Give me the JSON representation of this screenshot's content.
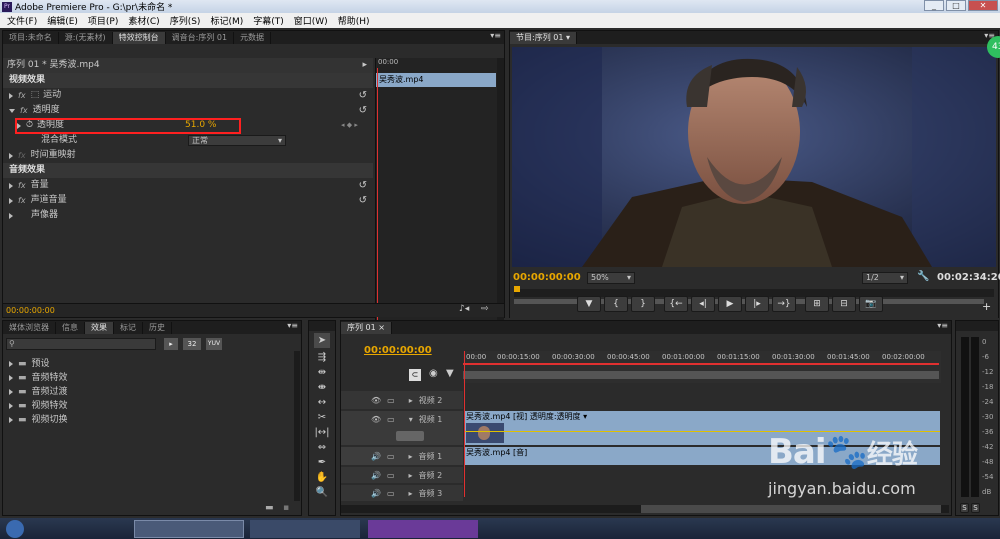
{
  "window": {
    "title": "Adobe Premiere Pro - G:\\pr\\未命名 *",
    "logo": "Pr"
  },
  "menu": [
    "文件(F)",
    "编辑(E)",
    "项目(P)",
    "素材(C)",
    "序列(S)",
    "标记(M)",
    "字幕(T)",
    "窗口(W)",
    "帮助(H)"
  ],
  "top_left_tabs": [
    "项目:未命名",
    "源:(无素材)",
    "特效控制台",
    "调音台:序列 01",
    "元数据"
  ],
  "effect_controls": {
    "clip_header": "序列 01 * 吴秀波.mp4",
    "clip_bar_label": "吴秀波.mp4",
    "mini_timecode": "00:00",
    "video_section": "视频效果",
    "rows": {
      "motion": "运动",
      "opacity": "透明度",
      "opacity_param": "透明度",
      "opacity_value": "51.0 %",
      "blend_mode": "混合模式",
      "blend_value": "正常",
      "time_remap": "时间重映射"
    },
    "audio_section": "音频效果",
    "audio_rows": [
      "音量",
      "声道音量",
      "声像器"
    ],
    "footer_timecode": "00:00:00:00",
    "fx_label": "fx"
  },
  "program": {
    "tab": "节目:序列 01",
    "timecode_current": "00:00:00:00",
    "zoom": "50%",
    "resolution": "1/2",
    "timecode_duration": "00:02:34:20"
  },
  "bottom_left_tabs": [
    "媒体浏览器",
    "信息",
    "效果",
    "标记",
    "历史"
  ],
  "effects_search_placeholder": "",
  "effects_badges": [
    "32",
    "YUV"
  ],
  "effects_folders": [
    "预设",
    "音频特效",
    "音频过渡",
    "视频特效",
    "视频切换"
  ],
  "timeline": {
    "tab": "序列 01",
    "timecode": "00:00:00:00",
    "ruler": [
      "00:00",
      "00:00:15:00",
      "00:00:30:00",
      "00:00:45:00",
      "00:01:00:00",
      "00:01:15:00",
      "00:01:30:00",
      "00:01:45:00",
      "00:02:00:00"
    ],
    "tracks": {
      "v2": "视频 2",
      "v1": "视频 1",
      "a1": "音频 1",
      "a2": "音频 2",
      "a3": "音频 3"
    },
    "video_clip": "吴秀波.mp4 [视] 透明度:透明度 ▾",
    "audio_clip": "吴秀波.mp4 [音]"
  },
  "meter_labels": [
    "0",
    "-6",
    "-12",
    "-18",
    "-24",
    "-30",
    "-36",
    "-42",
    "-48",
    "-54",
    "dB"
  ],
  "meter_buttons": [
    "S",
    "S"
  ],
  "watermark": {
    "brand": "Bai",
    "brand_suffix": "经验",
    "url": "jingyan.baidu.com"
  },
  "badge_number": "43",
  "colors": {
    "accent_timecode": "#e8a700",
    "highlight_box": "#ff2020",
    "clip_blue": "#8aa8c8",
    "playhead": "#e03030"
  }
}
